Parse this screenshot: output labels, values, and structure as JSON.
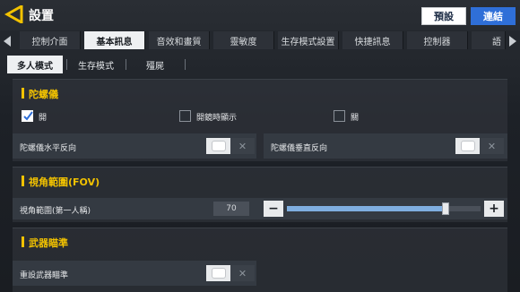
{
  "header": {
    "title": "設置",
    "preset_label": "預設",
    "link_label": "連結"
  },
  "tabs": [
    {
      "label": "控制介面",
      "active": false
    },
    {
      "label": "基本訊息",
      "active": true
    },
    {
      "label": "音效和畫質",
      "active": false
    },
    {
      "label": "靈敏度",
      "active": false
    },
    {
      "label": "生存模式設置",
      "active": false
    },
    {
      "label": "快捷訊息",
      "active": false
    },
    {
      "label": "控制器",
      "active": false
    },
    {
      "label": "語",
      "active": false
    }
  ],
  "subtabs": [
    {
      "label": "多人模式",
      "active": true
    },
    {
      "label": "生存模式",
      "active": false
    },
    {
      "label": "殭屍",
      "active": false
    }
  ],
  "gyro": {
    "title": "陀螺儀",
    "options": [
      {
        "label": "開",
        "checked": true
      },
      {
        "label": "開鏡時顯示",
        "checked": false
      },
      {
        "label": "關",
        "checked": false
      }
    ],
    "horizontal_label": "陀螺儀水平反向",
    "horizontal_on": true,
    "vertical_label": "陀螺儀垂直反向",
    "vertical_on": true
  },
  "fov": {
    "title": "視角範圍(FOV)",
    "label": "視角範圍(第一人稱)",
    "value": "70",
    "slider_fraction": 0.82,
    "minus": "−",
    "plus": "+"
  },
  "aim": {
    "title": "武器瞄準",
    "reset_label": "重設武器瞄準",
    "reset_on": true
  },
  "colors": {
    "accent": "#f2c200",
    "link_button": "#2f6fd8",
    "slider_fill": "#7faee0"
  },
  "icons": {
    "back": "back-arrow-icon",
    "tab_left": "chevron-left-icon",
    "tab_right": "chevron-right-icon",
    "toggle_off": "close-icon",
    "check": "checkmark-icon"
  }
}
